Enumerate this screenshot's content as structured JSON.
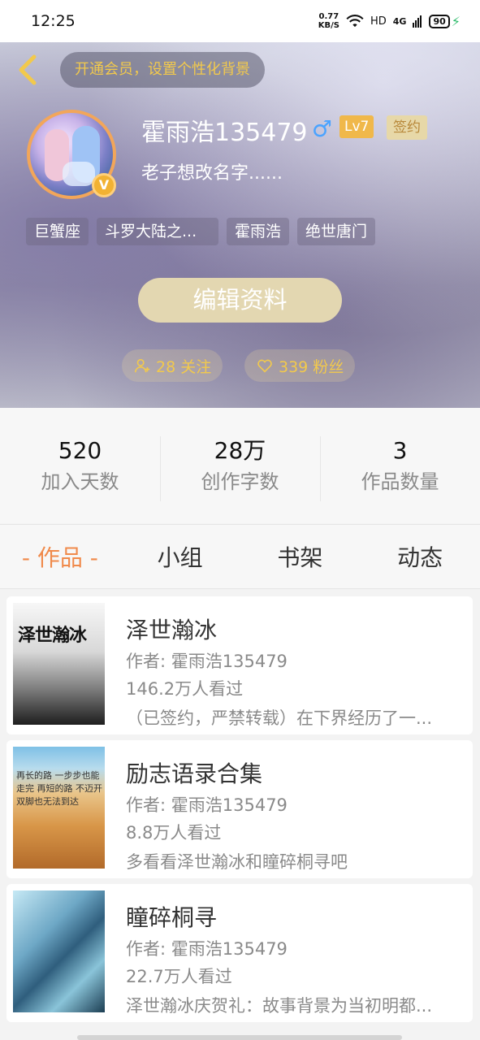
{
  "status_bar": {
    "time": "12:25",
    "net_speed_value": "0.77",
    "net_speed_unit": "KB/S",
    "network_hd": "HD",
    "network_4g": "4G",
    "battery": "90"
  },
  "header": {
    "vip_banner": "开通会员，设置个性化背景",
    "user_name": "霍雨浩135479",
    "gender_symbol": "♂",
    "level": "Lv7",
    "sign_badge": "签约",
    "verified_badge": "V",
    "bio": "老子想改名字......",
    "tags": [
      "巨蟹座",
      "斗罗大陆之...",
      "霍雨浩",
      "绝世唐门"
    ],
    "edit_button": "编辑资料",
    "follow_text": "28 关注",
    "fans_text": "339 粉丝"
  },
  "stats": [
    {
      "value": "520",
      "label": "加入天数"
    },
    {
      "value": "28万",
      "label": "创作字数"
    },
    {
      "value": "3",
      "label": "作品数量"
    }
  ],
  "tabs": [
    "- 作品 -",
    "小组",
    "书架",
    "动态"
  ],
  "works": [
    {
      "title": "泽世瀚冰",
      "author": "作者: 霍雨浩135479",
      "views": "146.2万人看过",
      "desc": "（已签约，严禁转载）在下界经历了一...",
      "cover_text": "泽世瀚冰"
    },
    {
      "title": "励志语录合集",
      "author": "作者: 霍雨浩135479",
      "views": "8.8万人看过",
      "desc": "多看看泽世瀚冰和瞳碎桐寻吧",
      "cover_text": "再长的路 一步步也能走完 再短的路 不迈开双脚也无法到达"
    },
    {
      "title": "瞳碎桐寻",
      "author": "作者: 霍雨浩135479",
      "views": "22.7万人看过",
      "desc": "泽世瀚冰庆贺礼：故事背景为当初明都...",
      "cover_text": ""
    }
  ],
  "colors": {
    "accent": "#f08a4b",
    "gold": "#f2c94c",
    "edit_button": "#e3d7b1"
  }
}
